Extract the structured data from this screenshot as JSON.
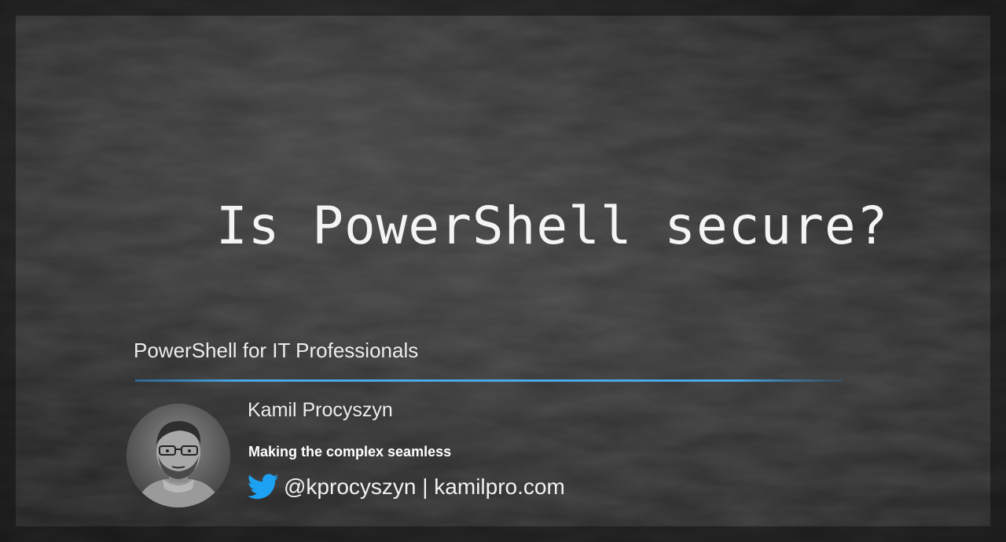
{
  "slide": {
    "title": "Is PowerShell secure?",
    "subtitle": "PowerShell for IT Professionals",
    "author": {
      "name": "Kamil Procyszyn",
      "tagline": "Making the complex seamless",
      "contact": "@kprocyszyn | kamilpro.com"
    },
    "icons": {
      "social": "twitter-icon"
    },
    "colors": {
      "background": "#1c1c1c",
      "text": "#ffffff",
      "divider_accent": "#3a9ad9",
      "twitter_blue": "#1da1f2"
    }
  }
}
